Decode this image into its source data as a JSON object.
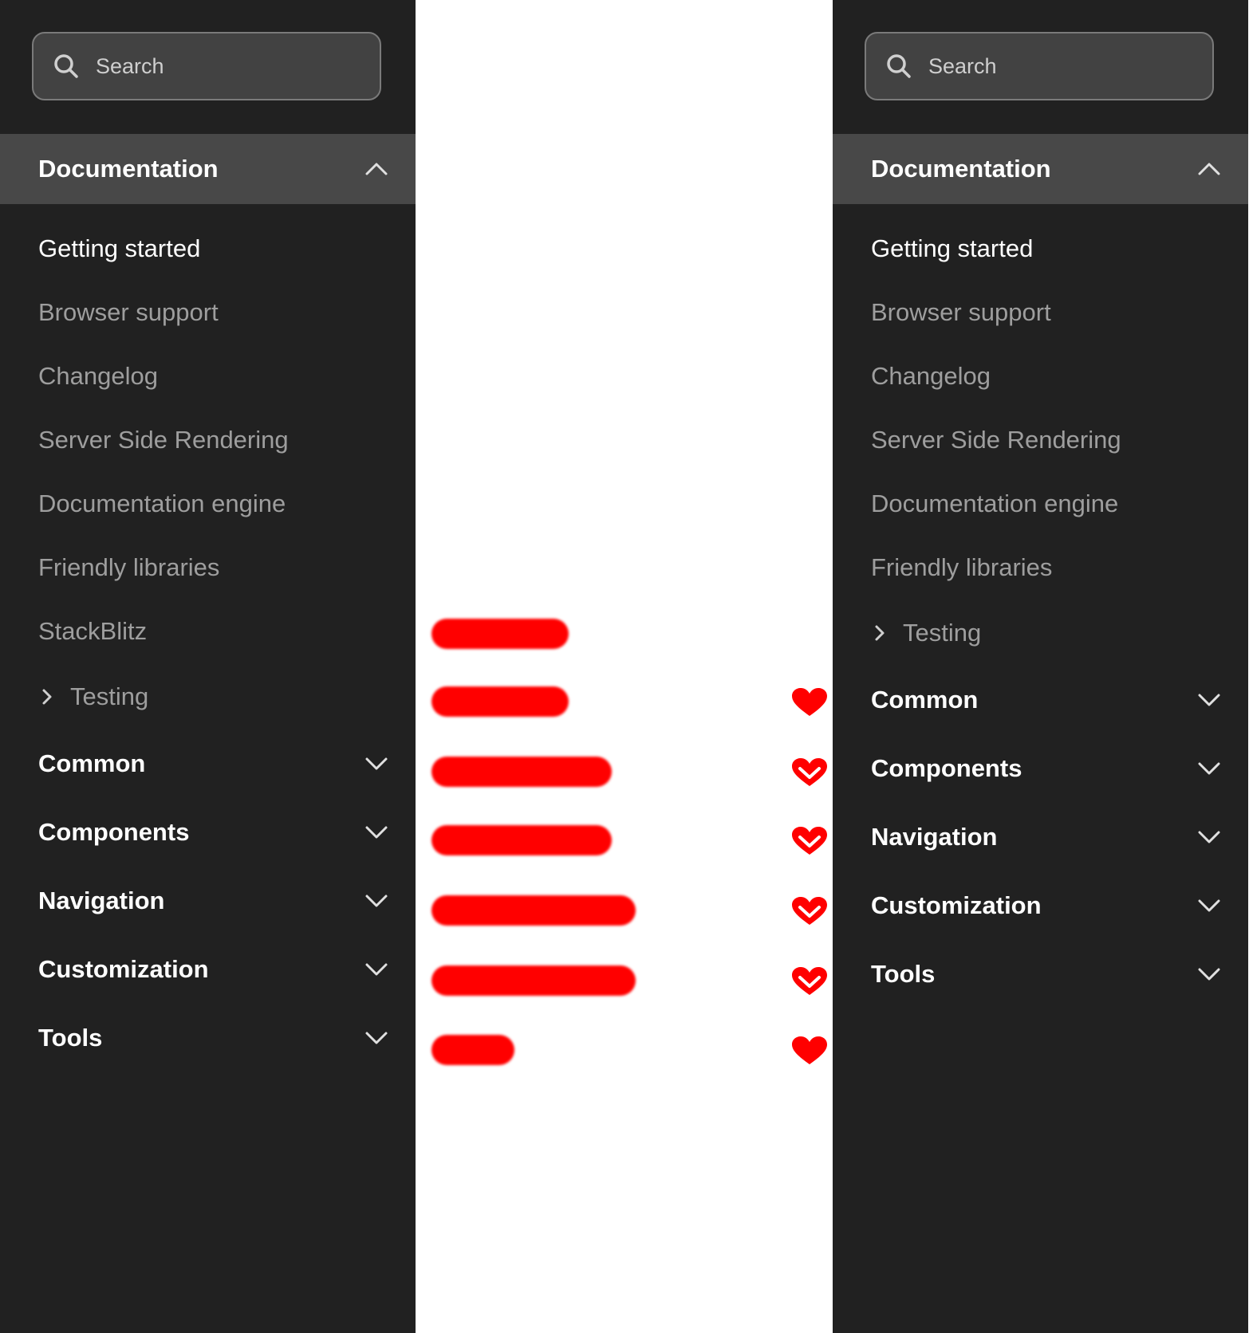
{
  "left_panel": {
    "search": {
      "placeholder": "Search"
    },
    "active_section": {
      "label": "Documentation",
      "expanded": true
    },
    "items": [
      {
        "label": "Getting started",
        "current": true
      },
      {
        "label": "Browser support"
      },
      {
        "label": "Changelog"
      },
      {
        "label": "Server Side Rendering"
      },
      {
        "label": "Documentation engine"
      },
      {
        "label": "Friendly libraries"
      },
      {
        "label": "StackBlitz"
      }
    ],
    "group": {
      "label": "Testing",
      "icon": "chevron-right-icon"
    },
    "sections": [
      {
        "label": "Common"
      },
      {
        "label": "Components"
      },
      {
        "label": "Navigation"
      },
      {
        "label": "Customization"
      },
      {
        "label": "Tools"
      }
    ]
  },
  "right_panel": {
    "search": {
      "placeholder": "Search"
    },
    "active_section": {
      "label": "Documentation",
      "expanded": true
    },
    "items": [
      {
        "label": "Getting started",
        "current": true
      },
      {
        "label": "Browser support"
      },
      {
        "label": "Changelog"
      },
      {
        "label": "Server Side Rendering"
      },
      {
        "label": "Documentation engine"
      },
      {
        "label": "Friendly libraries"
      }
    ],
    "group": {
      "label": "Testing",
      "icon": "chevron-right-icon"
    },
    "sections": [
      {
        "label": "Common"
      },
      {
        "label": "Components"
      },
      {
        "label": "Navigation"
      },
      {
        "label": "Customization"
      },
      {
        "label": "Tools"
      }
    ]
  },
  "middle_panel": {
    "redacted_rows": [
      {
        "heart": "none"
      },
      {
        "heart": "filled"
      },
      {
        "heart": "outline"
      },
      {
        "heart": "outline"
      },
      {
        "heart": "outline"
      },
      {
        "heart": "outline"
      },
      {
        "heart": "filled"
      }
    ]
  },
  "colors": {
    "panel_bg": "#212121",
    "active_section_bg": "#484848",
    "search_bg": "#424242",
    "text_primary": "#ffffff",
    "text_muted": "#9e9e9e",
    "redaction_red": "#ff0000"
  },
  "icons": {
    "search": "search-icon",
    "chevron_up": "chevron-up-icon",
    "chevron_down": "chevron-down-icon",
    "chevron_right": "chevron-right-icon",
    "heart": "heart-icon"
  }
}
